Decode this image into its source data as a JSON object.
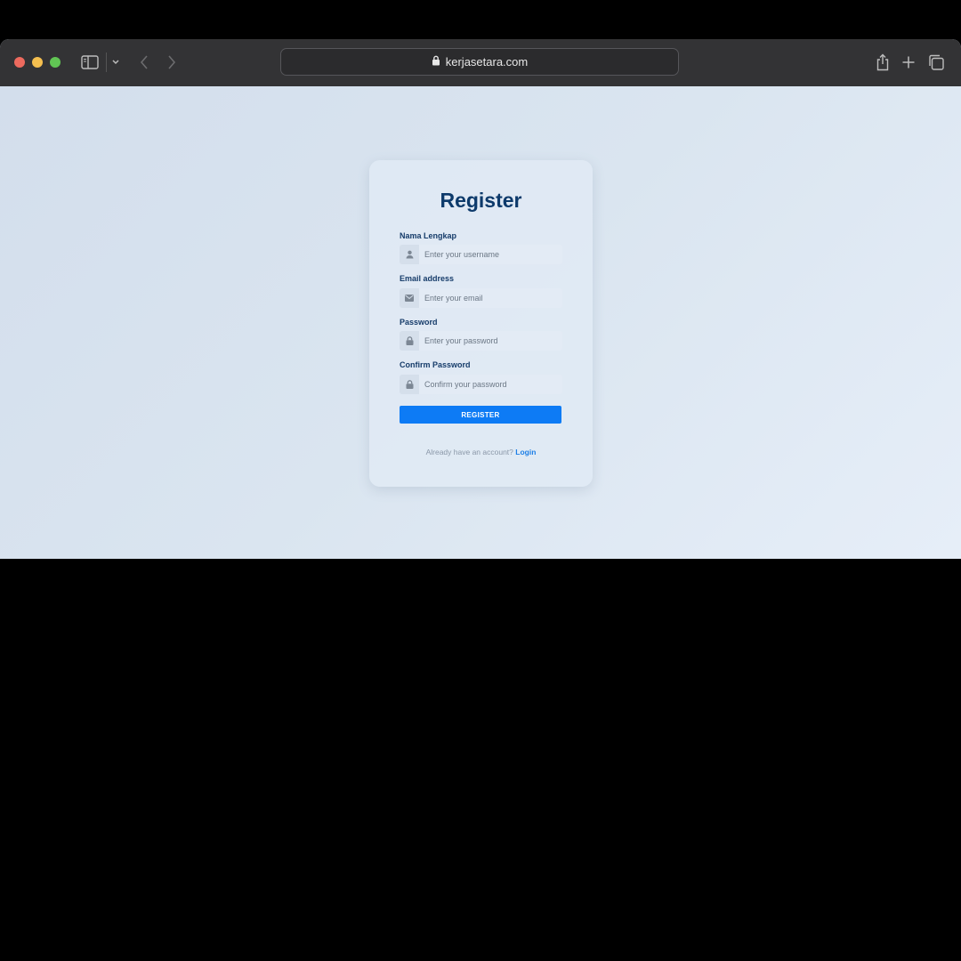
{
  "browser": {
    "url": "kerjasetara.com",
    "icons": {
      "sidebar": "sidebar-icon",
      "chevron": "chevron-down-icon",
      "back": "back-arrow-icon",
      "forward": "forward-arrow-icon",
      "lock": "lock-icon",
      "share": "share-icon",
      "new_tab": "plus-icon",
      "tabs": "tab-overview-icon"
    }
  },
  "form": {
    "title": "Register",
    "fields": [
      {
        "label": "Nama Lengkap",
        "placeholder": "Enter your username",
        "icon": "user-icon",
        "value": ""
      },
      {
        "label": "Email address",
        "placeholder": "Enter your email",
        "icon": "envelope-icon",
        "value": ""
      },
      {
        "label": "Password",
        "placeholder": "Enter your password",
        "icon": "lock-icon",
        "value": ""
      },
      {
        "label": "Confirm Password",
        "placeholder": "Confirm your password",
        "icon": "lock-icon",
        "value": ""
      }
    ],
    "submit_label": "REGISTER",
    "footer_text": "Already have an account?",
    "login_link": "Login"
  },
  "colors": {
    "accent": "#0d7bf5",
    "title": "#0d3a6b",
    "link": "#1d7fe6"
  }
}
